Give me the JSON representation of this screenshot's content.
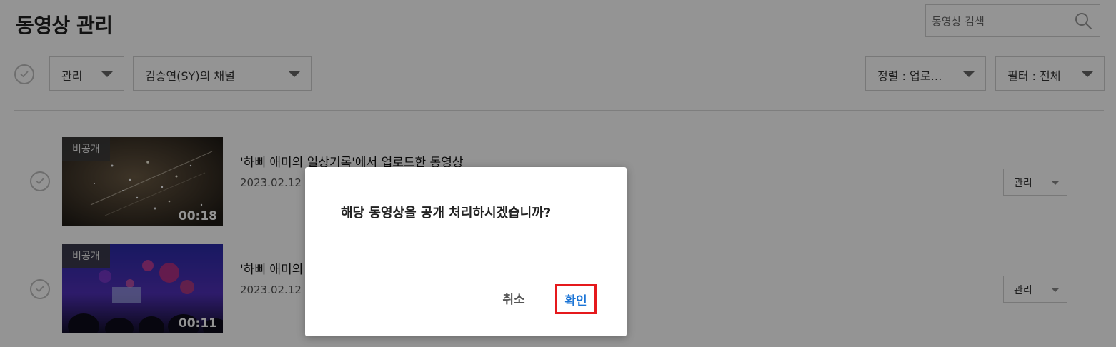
{
  "header": {
    "title": "동영상 관리",
    "search": {
      "placeholder": "동영상 검색",
      "value": ""
    },
    "search_icon": "search-icon"
  },
  "toolbar": {
    "manage_label": "관리",
    "channel_label": "김승연(SY)의 채널",
    "sort_label": "정렬 : 업로…",
    "filter_label": "필터 : 전체"
  },
  "videos": [
    {
      "visibility": "비공개",
      "duration": "00:18",
      "title": "'하삐 애미의 일상기록'에서 업로드한 동영상",
      "date": "2023.02.12 1",
      "manage_label": "관리"
    },
    {
      "visibility": "비공개",
      "duration": "00:11",
      "title": "'하삐 애미의",
      "date": "2023.02.12 1",
      "manage_label": "관리"
    }
  ],
  "dialog": {
    "message": "해당 동영상을 공개 처리하시겠습니까?",
    "cancel_label": "취소",
    "confirm_label": "확인"
  },
  "colors": {
    "confirm_text": "#1a74d6",
    "highlight_border": "#e5191c",
    "overlay": "rgba(0,0,0,0.42)"
  }
}
